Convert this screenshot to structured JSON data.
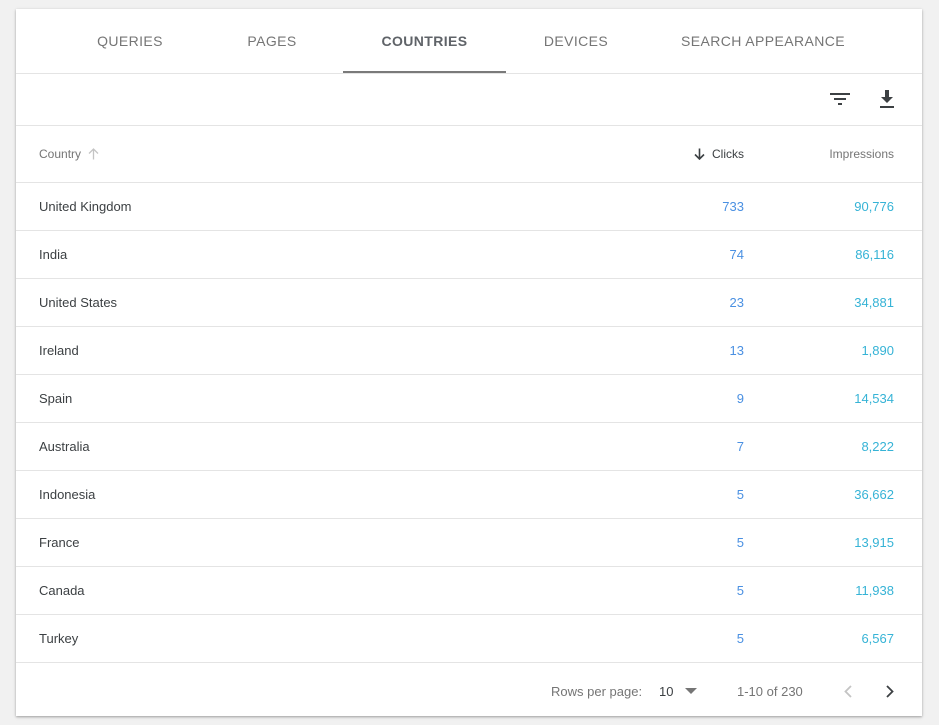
{
  "tabs": [
    {
      "label": "QUERIES",
      "active": false
    },
    {
      "label": "PAGES",
      "active": false
    },
    {
      "label": "COUNTRIES",
      "active": true
    },
    {
      "label": "DEVICES",
      "active": false
    },
    {
      "label": "SEARCH APPEARANCE",
      "active": false
    }
  ],
  "toolbar": {
    "filter_icon": "filter-icon",
    "download_icon": "download-icon"
  },
  "table": {
    "columns": {
      "country": "Country",
      "clicks": "Clicks",
      "impressions": "Impressions"
    },
    "rows": [
      {
        "country": "United Kingdom",
        "clicks": "733",
        "impressions": "90,776"
      },
      {
        "country": "India",
        "clicks": "74",
        "impressions": "86,116"
      },
      {
        "country": "United States",
        "clicks": "23",
        "impressions": "34,881"
      },
      {
        "country": "Ireland",
        "clicks": "13",
        "impressions": "1,890"
      },
      {
        "country": "Spain",
        "clicks": "9",
        "impressions": "14,534"
      },
      {
        "country": "Australia",
        "clicks": "7",
        "impressions": "8,222"
      },
      {
        "country": "Indonesia",
        "clicks": "5",
        "impressions": "36,662"
      },
      {
        "country": "France",
        "clicks": "5",
        "impressions": "13,915"
      },
      {
        "country": "Canada",
        "clicks": "5",
        "impressions": "11,938"
      },
      {
        "country": "Turkey",
        "clicks": "5",
        "impressions": "6,567"
      }
    ]
  },
  "pagination": {
    "rows_per_page_label": "Rows per page:",
    "rows_per_page_value": "10",
    "range": "1-10 of 230"
  },
  "colors": {
    "clicks": "#4a90e2",
    "impressions": "#36b3d6",
    "tab_indicator": "#7a7a7a"
  }
}
